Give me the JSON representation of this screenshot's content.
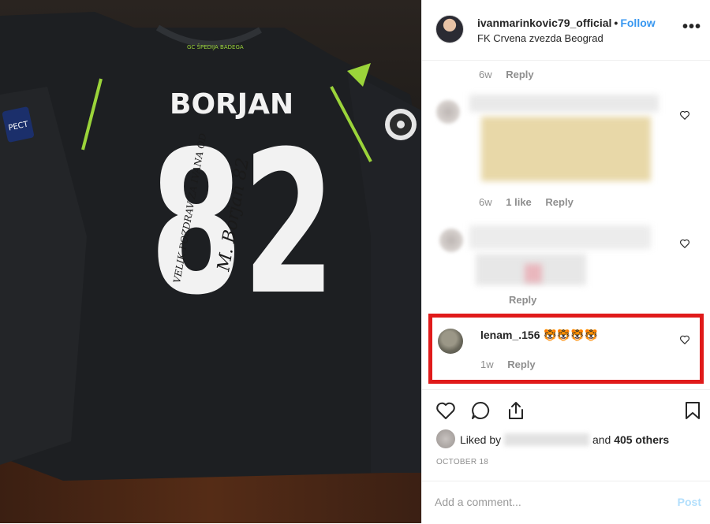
{
  "post": {
    "username": "ivanmarinkovic79_official",
    "separator": "•",
    "follow_label": "Follow",
    "location": "FK Crvena zvezda Beograd",
    "more_icon": "more-horizontal-icon"
  },
  "photo": {
    "collar_text": "GC ŠPEDIJA BADEGA",
    "player_name": "BORJAN",
    "number": "82",
    "badge_text": "PECT",
    "signature_dedication": "VELIK POZDRAV ZA IVANA OD",
    "signature": "M. Borjan 82"
  },
  "comments": [
    {
      "time": "6w",
      "reply_label": "Reply"
    },
    {
      "time": "6w",
      "likes": "1 like",
      "reply_label": "Reply",
      "blurred_text": "e... ...a ..."
    },
    {
      "blurred_text": "depostor do k... vonk...",
      "reply_label": "Reply"
    },
    {
      "username": "lenam_.156",
      "emojis": "🐯🐯🐯🐯",
      "time": "1w",
      "reply_label": "Reply"
    }
  ],
  "actions": {
    "like_icon": "heart-icon",
    "comment_icon": "comment-icon",
    "share_icon": "share-icon",
    "save_icon": "bookmark-icon"
  },
  "likes": {
    "prefix": "Liked by",
    "suffix_and": "and",
    "count": "405 others"
  },
  "date": "OCTOBER 18",
  "add_comment": {
    "placeholder": "Add a comment...",
    "post_label": "Post"
  },
  "colors": {
    "link_blue": "#3897f0",
    "highlight_red": "#e01a1a",
    "jersey": "#1d1f22",
    "jersey_accent": "#9bd43a"
  }
}
